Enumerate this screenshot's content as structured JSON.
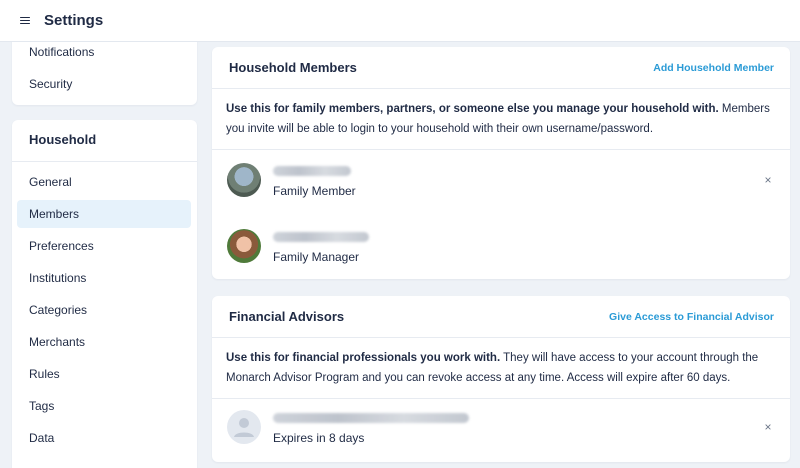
{
  "header": {
    "menu_icon": "hamburger-menu-icon",
    "title": "Settings"
  },
  "sidebar": {
    "top_items": [
      {
        "label": "Notifications"
      },
      {
        "label": "Security"
      }
    ],
    "household_heading": "Household",
    "household_items": [
      {
        "label": "General",
        "active": false
      },
      {
        "label": "Members",
        "active": true
      },
      {
        "label": "Preferences",
        "active": false
      },
      {
        "label": "Institutions",
        "active": false
      },
      {
        "label": "Categories",
        "active": false
      },
      {
        "label": "Merchants",
        "active": false
      },
      {
        "label": "Rules",
        "active": false
      },
      {
        "label": "Tags",
        "active": false
      },
      {
        "label": "Data",
        "active": false
      }
    ]
  },
  "household_members": {
    "title": "Household Members",
    "action": "Add Household Member",
    "desc_bold": "Use this for family members, partners, or someone else you manage your household with.",
    "desc_rest": " Members you invite will be able to login to your household with their own username/password.",
    "members": [
      {
        "role": "Family Member",
        "removable": true,
        "name_redacted": true
      },
      {
        "role": "Family Manager",
        "removable": false,
        "name_redacted": true
      }
    ]
  },
  "financial_advisors": {
    "title": "Financial Advisors",
    "action": "Give Access to Financial Advisor",
    "desc_bold": "Use this for financial professionals you work with.",
    "desc_rest": " They will have access to your account through the Monarch Advisor Program and you can revoke access at any time. Access will expire after 60 days.",
    "advisors": [
      {
        "status": "Expires in 8 days",
        "removable": true,
        "name_redacted": true
      }
    ]
  },
  "icons": {
    "remove": "×",
    "default_avatar": "user-silhouette-icon"
  },
  "colors": {
    "accent": "#2b9bd6",
    "active_bg": "#e6f2fb",
    "page_bg": "#eef2f7",
    "text": "#1f2a44"
  }
}
